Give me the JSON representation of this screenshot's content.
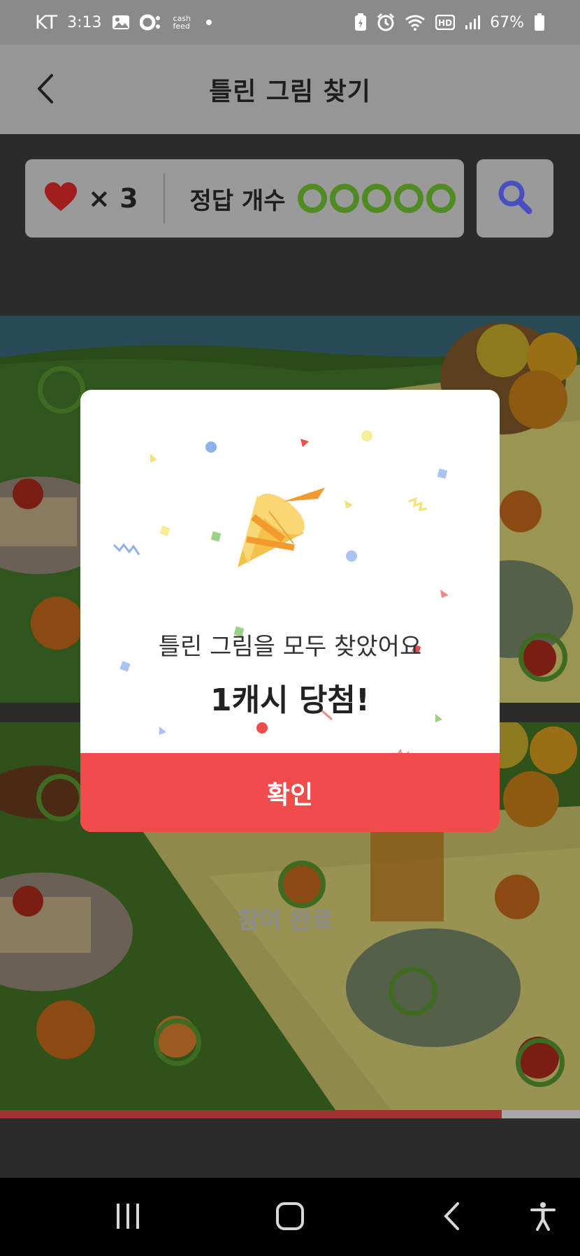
{
  "status_bar": {
    "carrier": "KT",
    "time": "3:13",
    "cash_feed_label": "cash feed",
    "battery": "67%",
    "icons": [
      "image-icon",
      "cashfeed-icon",
      "dot-icon",
      "battery-saver-icon",
      "alarm-icon",
      "wifi-icon",
      "hd-icon",
      "signal-icon",
      "battery-icon"
    ]
  },
  "header": {
    "title": "틀린 그림 찾기",
    "back_icon": "chevron-left-icon"
  },
  "game_panel": {
    "lives_icon": "heart-icon",
    "lives_count": "× 3",
    "answers_label": "정답 개수",
    "answers_found": 5,
    "answers_total": 5,
    "hint_icon": "magnifier-icon"
  },
  "images": {
    "participation_text": "참여 완료",
    "progress_fraction": 0.865
  },
  "modal": {
    "message": "틀린 그림을 모두 찾았어요",
    "reward": "1캐시 당첨!",
    "confirm_label": "확인",
    "illustration_icon": "party-popper-icon"
  },
  "nav_bar": {
    "icons": [
      "recent-apps-icon",
      "home-icon",
      "back-icon",
      "accessibility-icon"
    ]
  },
  "colors": {
    "accent_red": "#f04c4c",
    "answer_green": "#4f8a23",
    "hint_blue": "#4a4fc0"
  }
}
